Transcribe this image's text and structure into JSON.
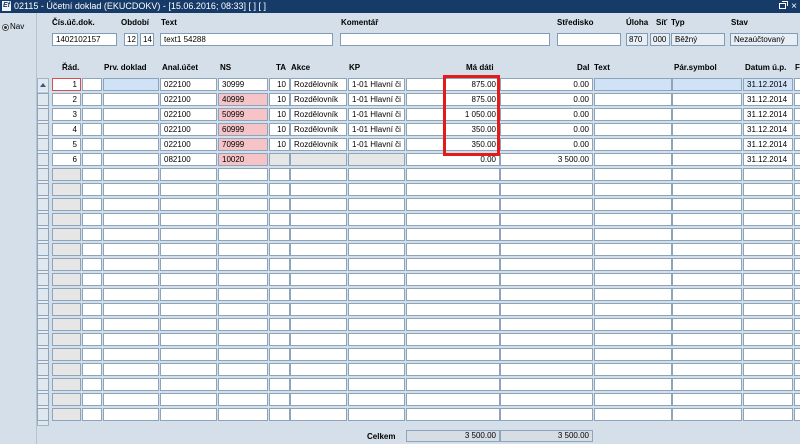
{
  "window": {
    "title": "02115 - Účetní doklad (EKUCDOKV) - [15.06.2016; 08:33]  [ ]  [ ]",
    "app_icon": "Ef"
  },
  "nav": {
    "label": "Nav"
  },
  "header": {
    "labels": {
      "cis_uc_dok": "Čís.úč.dok.",
      "obdobi": "Období",
      "text": "Text",
      "komentar": "Komentář",
      "stredisko": "Středisko",
      "uloha": "Úloha",
      "sit": "Síť",
      "typ": "Typ",
      "stav": "Stav"
    },
    "values": {
      "cis_uc_dok": "1402102157",
      "obdobi_month": "12",
      "obdobi_year": "14",
      "text": "text1 54288",
      "komentar": "",
      "stredisko": "",
      "uloha": "870",
      "sit": "000",
      "typ": "Běžný",
      "stav": "Nezaúčtovaný"
    }
  },
  "grid": {
    "columns": [
      "Řád.",
      "Prv. doklad",
      "Anal.účet",
      "NS",
      "TA",
      "Akce",
      "KP",
      "Má dáti",
      "Dal",
      "Text",
      "Pár.symbol",
      "Datum ú.p.",
      "F"
    ],
    "rows": [
      {
        "rad": "1",
        "prv": "",
        "anal": "022100",
        "ns": "30999",
        "ta": "10",
        "akce": "Rozdělovník",
        "kp": "1-01 Hlavní či",
        "ma_dati": "875.00",
        "dal": "0.00",
        "text": "",
        "par": "",
        "datum": "31.12.2014",
        "current": true,
        "ns_pink": false
      },
      {
        "rad": "2",
        "prv": "",
        "anal": "022100",
        "ns": "40999",
        "ta": "10",
        "akce": "Rozdělovník",
        "kp": "1-01 Hlavní či",
        "ma_dati": "875.00",
        "dal": "0.00",
        "text": "",
        "par": "",
        "datum": "31.12.2014",
        "current": false,
        "ns_pink": true
      },
      {
        "rad": "3",
        "prv": "",
        "anal": "022100",
        "ns": "50999",
        "ta": "10",
        "akce": "Rozdělovník",
        "kp": "1-01 Hlavní či",
        "ma_dati": "1 050.00",
        "dal": "0.00",
        "text": "",
        "par": "",
        "datum": "31.12.2014",
        "current": false,
        "ns_pink": true
      },
      {
        "rad": "4",
        "prv": "",
        "anal": "022100",
        "ns": "60999",
        "ta": "10",
        "akce": "Rozdělovník",
        "kp": "1-01 Hlavní či",
        "ma_dati": "350.00",
        "dal": "0.00",
        "text": "",
        "par": "",
        "datum": "31.12.2014",
        "current": false,
        "ns_pink": true
      },
      {
        "rad": "5",
        "prv": "",
        "anal": "022100",
        "ns": "70999",
        "ta": "10",
        "akce": "Rozdělovník",
        "kp": "1-01 Hlavní či",
        "ma_dati": "350.00",
        "dal": "0.00",
        "text": "",
        "par": "",
        "datum": "31.12.2014",
        "current": false,
        "ns_pink": true
      },
      {
        "rad": "6",
        "prv": "",
        "anal": "082100",
        "ns": "10020",
        "ta": "",
        "akce": "",
        "kp": "",
        "ma_dati": "0.00",
        "dal": "3 500.00",
        "text": "",
        "par": "",
        "datum": "31.12.2014",
        "current": false,
        "ns_pink": true
      }
    ]
  },
  "totals": {
    "label": "Celkem",
    "ma_dati": "3 500.00",
    "dal": "3 500.00"
  }
}
